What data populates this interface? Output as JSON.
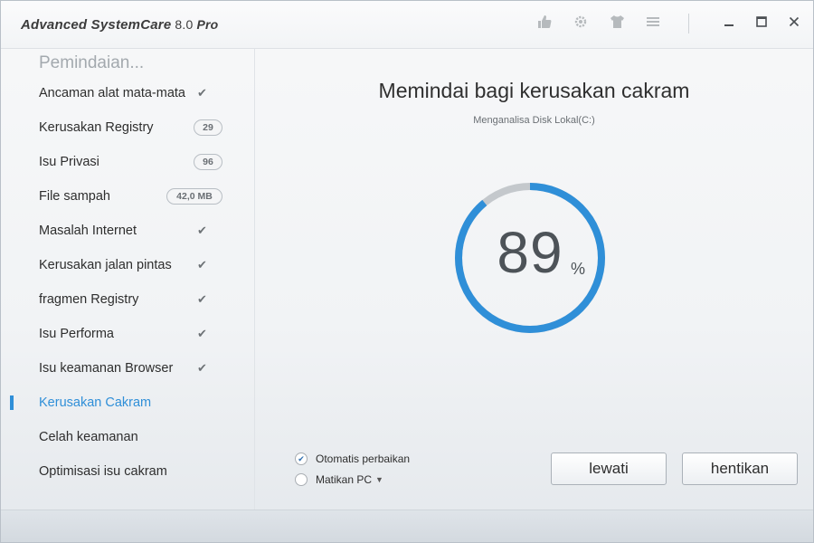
{
  "window": {
    "app_name": "Advanced SystemCare",
    "version": "8.0",
    "edition": "Pro"
  },
  "toolbar_icons": [
    "thumbs-up-icon",
    "gear-icon",
    "tshirt-icon",
    "menu-icon"
  ],
  "window_controls": {
    "minimize": "—",
    "maximize": "☐",
    "close": "✕"
  },
  "sidebar": {
    "header": "Pemindaian...",
    "items": [
      {
        "label": "Ancaman alat mata-mata",
        "status": "done",
        "badge": ""
      },
      {
        "label": "Kerusakan Registry",
        "status": "count",
        "badge": "29"
      },
      {
        "label": "Isu Privasi",
        "status": "count",
        "badge": "96"
      },
      {
        "label": "File sampah",
        "status": "count",
        "badge": "42,0 MB"
      },
      {
        "label": "Masalah Internet",
        "status": "done",
        "badge": ""
      },
      {
        "label": "Kerusakan jalan pintas",
        "status": "done",
        "badge": ""
      },
      {
        "label": "fragmen Registry",
        "status": "done",
        "badge": ""
      },
      {
        "label": "Isu Performa",
        "status": "done",
        "badge": ""
      },
      {
        "label": "Isu keamanan Browser",
        "status": "done",
        "badge": ""
      },
      {
        "label": "Kerusakan Cakram",
        "status": "active",
        "badge": ""
      },
      {
        "label": "Celah keamanan",
        "status": "pending",
        "badge": ""
      },
      {
        "label": "Optimisasi isu cakram",
        "status": "pending",
        "badge": ""
      }
    ]
  },
  "main": {
    "title": "Memindai bagi kerusakan cakram",
    "subtitle": "Menganalisa Disk Lokal(C:)",
    "progress_value": "89",
    "progress_unit": "%",
    "progress_fraction": 0.89,
    "options": [
      {
        "label": "Otomatis perbaikan",
        "checked": true,
        "dropdown": false
      },
      {
        "label": "Matikan PC",
        "checked": false,
        "dropdown": true
      }
    ],
    "buttons": {
      "skip": "lewati",
      "stop": "hentikan"
    }
  },
  "colors": {
    "accent": "#2f8fd8",
    "ring_remaining": "#c4c8cc",
    "text": "#2e2e2e"
  }
}
